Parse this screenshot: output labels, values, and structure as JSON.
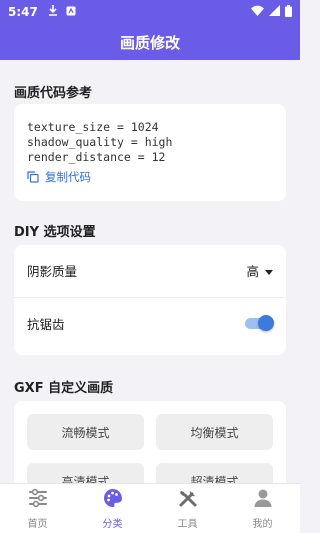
{
  "status": {
    "time": "5:47"
  },
  "app": {
    "title": "画质修改"
  },
  "code_section": {
    "title": "画质代码参考",
    "lines": [
      "texture_size = 1024",
      "shadow_quality = high",
      "render_distance = 12"
    ],
    "copy_label": "复制代码"
  },
  "diy_section": {
    "title": "DIY 选项设置",
    "shadow_label": "阴影质量",
    "shadow_value": "高",
    "aa_label": "抗锯齿",
    "aa_enabled": true
  },
  "gxf_section": {
    "title": "GXF 自定义画质",
    "modes": [
      "流畅模式",
      "均衡模式",
      "高清模式",
      "超清模式"
    ]
  },
  "nav": {
    "items": [
      {
        "label": "首页",
        "icon": "sliders-icon"
      },
      {
        "label": "分类",
        "icon": "palette-icon"
      },
      {
        "label": "工具",
        "icon": "tools-icon"
      },
      {
        "label": "我的",
        "icon": "person-icon"
      }
    ],
    "active_index": 1
  },
  "colors": {
    "primary": "#6b5ce7",
    "accent": "#3b7be0",
    "link": "#2f6fde"
  }
}
